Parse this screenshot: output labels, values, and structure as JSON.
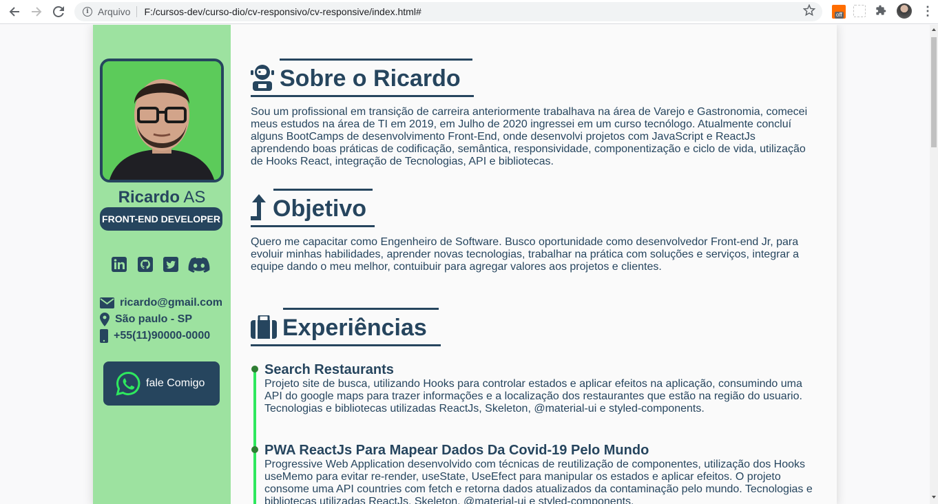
{
  "browser": {
    "scheme_label": "Arquivo",
    "url": "F:/cursos-dev/curso-dio/cv-responsivo/cv-responsive/index.html#",
    "ext_badge": "off"
  },
  "sidebar": {
    "first_name": "Ricardo",
    "last_name": "AS",
    "role": "FRONT-END DEVELOPER",
    "contacts": [
      {
        "icon": "envelope-icon",
        "text": "ricardo@gmail.com"
      },
      {
        "icon": "map-marker-icon",
        "text": "São paulo - SP"
      },
      {
        "icon": "mobile-phone-icon",
        "text": "+55(11)90000-0000"
      }
    ],
    "whatsapp_label": "fale Comigo"
  },
  "main": {
    "about_title": "Sobre o Ricardo",
    "about_text": "Sou um profissional em transição de carreira anteriormente trabalhava na área de Varejo e Gastronomia, comecei meus estudos na área de TI em 2019, em Julho de 2020 ingressei em um curso tecnólogo. Atualmente concluí alguns BootCamps de desenvolvimento Front-End, onde desenvolvi projetos com JavaScript e ReactJs aprendendo boas práticas de codificação, semântica, responsividade, componentização e ciclo de vida, utilização de Hooks React, integração de Tecnologias, API e bibliotecas.",
    "objective_title": "Objetivo",
    "objective_text": "Quero me capacitar como Engenheiro de Software. Busco oportunidade como desenvolvedor Front-end Jr, para evoluir minhas habilidades, aprender novas tecnologias, trabalhar na prática com soluções e serviços, integrar a equipe dando o meu melhor, contuibuir para agregar valores aos projetos e clientes.",
    "experience_title": "Experiências",
    "experiences": [
      {
        "title": "Search Restaurants",
        "desc": "Projeto site de busca, utilizando Hooks para controlar estados e aplicar efeitos na aplicação, consumindo uma API do google maps para trazer informações e a localização dos restaurantes que estão na região do usuario. Tecnologias e bibliotecas utilizadas ReactJs, Skeleton, @material-ui e styled-components."
      },
      {
        "title": "PWA ReactJs Para Mapear Dados Da Covid-19 Pelo Mundo",
        "desc": "Progressive Web Application desenvolvido com técnicas de reutilização de componentes, utilização dos Hooks useMemo para evitar re-render, useState, UseEfect para manipular os estados e aplicar efeitos. O projeto consome uma API countries com fetch e retorna dados atualizados da contaminação pelo mundo. Tecnologias e bibliotecas utilizadas ReactJs, Skeleton, @material-ui e styled-components."
      }
    ]
  },
  "colors": {
    "primary": "#26455e",
    "sidebar_bg": "#9de2a0",
    "timeline": "#2ee85e"
  }
}
